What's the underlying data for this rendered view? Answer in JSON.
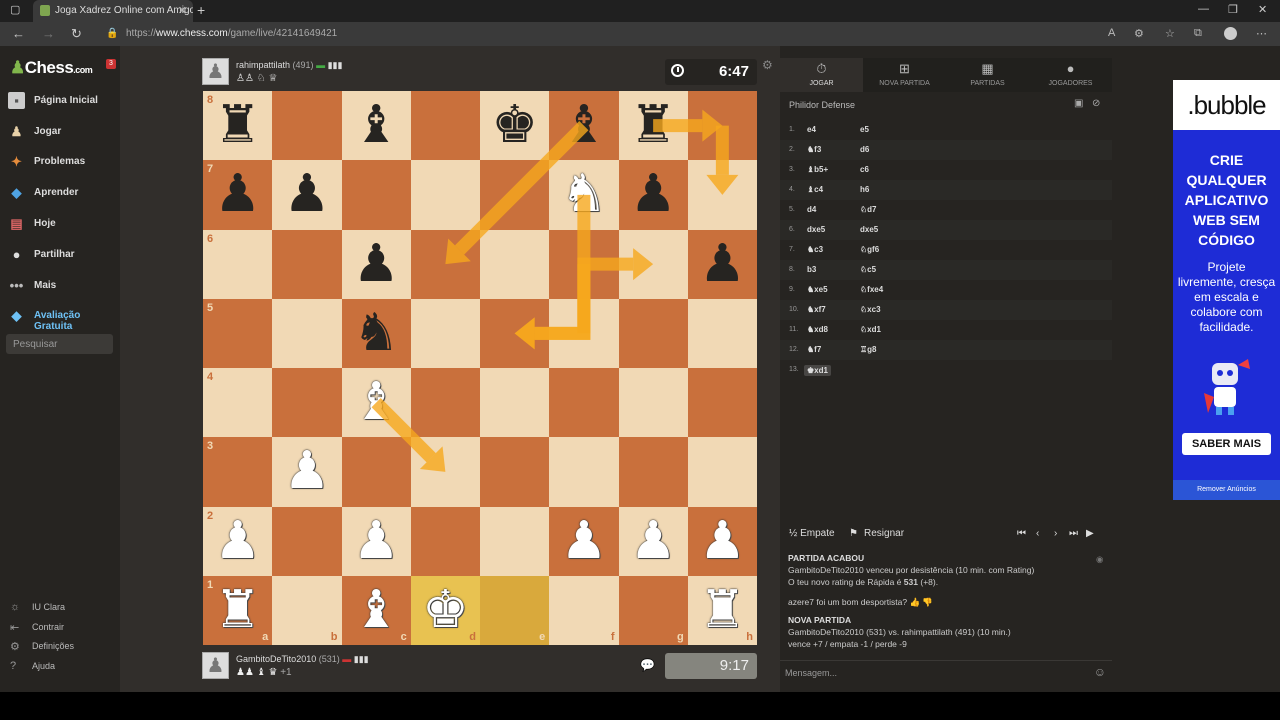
{
  "browser": {
    "tab_title": "Joga Xadrez Online com Amigos",
    "url_prefix": "https://",
    "url_host": "www.chess.com",
    "url_path": "/game/live/42141649421"
  },
  "sidebar": {
    "logo": "Chess",
    "logo_suffix": ".com",
    "badge": "3",
    "items": [
      {
        "label": "Página Inicial",
        "icon": "home-icon"
      },
      {
        "label": "Jogar",
        "icon": "play-icon"
      },
      {
        "label": "Problemas",
        "icon": "puzzle-icon"
      },
      {
        "label": "Aprender",
        "icon": "learn-icon"
      },
      {
        "label": "Hoje",
        "icon": "news-icon"
      },
      {
        "label": "Partilhar",
        "icon": "social-icon"
      },
      {
        "label": "Mais",
        "icon": "more-icon"
      },
      {
        "label": "Avaliação Gratuita",
        "icon": "diamond-icon"
      }
    ],
    "search_placeholder": "Pesquisar",
    "footer": [
      "IU Clara",
      "Contrair",
      "Definições",
      "Ajuda"
    ]
  },
  "top_player": {
    "name": "rahimpattilath",
    "rating": "(491)",
    "clock": "6:47"
  },
  "bottom_player": {
    "name": "GambitoDeTito2010",
    "rating": "(531)",
    "material": "+1",
    "clock": "9:17"
  },
  "board": {
    "files": [
      "a",
      "b",
      "c",
      "d",
      "e",
      "f",
      "g",
      "h"
    ],
    "ranks": [
      "8",
      "7",
      "6",
      "5",
      "4",
      "3",
      "2",
      "1"
    ],
    "pieces": [
      {
        "sq": "a8",
        "p": "♜",
        "c": "b"
      },
      {
        "sq": "c8",
        "p": "♝",
        "c": "b"
      },
      {
        "sq": "e8",
        "p": "♚",
        "c": "b"
      },
      {
        "sq": "f8",
        "p": "♝",
        "c": "b"
      },
      {
        "sq": "g8",
        "p": "♜",
        "c": "b"
      },
      {
        "sq": "a7",
        "p": "♟",
        "c": "b"
      },
      {
        "sq": "b7",
        "p": "♟",
        "c": "b"
      },
      {
        "sq": "f7",
        "p": "♞",
        "c": "w"
      },
      {
        "sq": "g7",
        "p": "♟",
        "c": "b"
      },
      {
        "sq": "c6",
        "p": "♟",
        "c": "b"
      },
      {
        "sq": "h6",
        "p": "♟",
        "c": "b"
      },
      {
        "sq": "c5",
        "p": "♞",
        "c": "b"
      },
      {
        "sq": "c4",
        "p": "♝",
        "c": "w"
      },
      {
        "sq": "b3",
        "p": "♟",
        "c": "w"
      },
      {
        "sq": "a2",
        "p": "♟",
        "c": "w"
      },
      {
        "sq": "c2",
        "p": "♟",
        "c": "w"
      },
      {
        "sq": "f2",
        "p": "♟",
        "c": "w"
      },
      {
        "sq": "g2",
        "p": "♟",
        "c": "w"
      },
      {
        "sq": "h2",
        "p": "♟",
        "c": "w"
      },
      {
        "sq": "a1",
        "p": "♜",
        "c": "w"
      },
      {
        "sq": "c1",
        "p": "♝",
        "c": "w"
      },
      {
        "sq": "d1",
        "p": "♚",
        "c": "w"
      },
      {
        "sq": "h1",
        "p": "♜",
        "c": "w"
      }
    ],
    "highlight": [
      "d1",
      "e1"
    ],
    "arrows": [
      {
        "from": "f8",
        "to": "d6"
      },
      {
        "from": "g8",
        "to": "h8"
      },
      {
        "from": "h8",
        "to": "h7"
      },
      {
        "from": "c4",
        "to": "d3"
      },
      {
        "from": "f6",
        "to": "e5",
        "knight": true
      },
      {
        "from": "f7",
        "to": "e5",
        "knight": true
      },
      {
        "from": "f5",
        "to": "g6",
        "knight": true
      }
    ],
    "colors": {
      "light": "#f1d9b5",
      "dark": "#c9703c",
      "arrow": "#f6a81d"
    }
  },
  "panel": {
    "tabs": [
      {
        "label": "JOGAR",
        "icon": "clock-icon"
      },
      {
        "label": "NOVA PARTIDA",
        "icon": "plus-icon"
      },
      {
        "label": "PARTIDAS",
        "icon": "board-icon"
      },
      {
        "label": "JOGADORES",
        "icon": "players-icon"
      }
    ],
    "opening": "Philidor Defense",
    "moves": [
      {
        "n": "1.",
        "w": "e4",
        "b": "e5"
      },
      {
        "n": "2.",
        "w": "♞f3",
        "b": "d6"
      },
      {
        "n": "3.",
        "w": "♝b5+",
        "b": "c6"
      },
      {
        "n": "4.",
        "w": "♝c4",
        "b": "h6"
      },
      {
        "n": "5.",
        "w": "d4",
        "b": "♘d7"
      },
      {
        "n": "6.",
        "w": "dxe5",
        "b": "dxe5"
      },
      {
        "n": "7.",
        "w": "♞c3",
        "b": "♘gf6"
      },
      {
        "n": "8.",
        "w": "b3",
        "b": "♘c5"
      },
      {
        "n": "9.",
        "w": "♞xe5",
        "b": "♘fxe4"
      },
      {
        "n": "10.",
        "w": "♞xf7",
        "b": "♘xc3"
      },
      {
        "n": "11.",
        "w": "♞xd8",
        "b": "♘xd1"
      },
      {
        "n": "12.",
        "w": "♞f7",
        "b": "♖g8"
      },
      {
        "n": "13.",
        "w": "♚xd1",
        "b": ""
      }
    ],
    "draw_label": "½ Empate",
    "resign_label": "Resignar",
    "log": {
      "ended": "PARTIDA ACABOU",
      "result": "GambitoDeTito2010 venceu por desistência (10 min. com Rating)",
      "rating_prefix": "O teu novo rating de Rápida é",
      "rating_value": "531",
      "rating_suffix": "(+8).",
      "sport": "azere7 foi um bom desportista?",
      "new_game": "NOVA PARTIDA",
      "matchup": "GambitoDeTito2010 (531) vs. rahimpattilath (491) (10 min.)",
      "odds": "vence +7 / empata -1 / perde -9"
    },
    "message_placeholder": "Mensagem..."
  },
  "ad": {
    "logo": ".bubble",
    "headline": "CRIE QUALQUER APLICATIVO WEB SEM CÓDIGO",
    "sub": "Projete livremente, cresça em escala e colabore com facilidade.",
    "button": "SABER MAIS",
    "remove": "Remover Anúncios",
    "bg": "#1e2cd6"
  }
}
